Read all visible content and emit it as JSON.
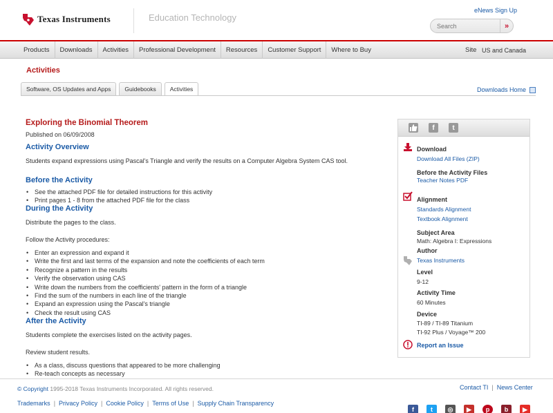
{
  "header": {
    "brand": "Texas Instruments",
    "section": "Education Technology",
    "enews_link": "eNews Sign Up",
    "search_placeholder": "Search"
  },
  "nav": {
    "items": [
      "Products",
      "Downloads",
      "Activities",
      "Professional Development",
      "Resources",
      "Customer Support",
      "Where to Buy"
    ],
    "site_label": "Site",
    "site_value": "US and Canada"
  },
  "page": {
    "section_title": "Activities",
    "tabs": [
      "Software, OS Updates and Apps",
      "Guidebooks",
      "Activities"
    ],
    "active_tab": "Activities",
    "downloads_home": "Downloads Home"
  },
  "activity": {
    "title": "Exploring the Binomial Theorem",
    "published": "Published on 06/09/2008",
    "overview_heading": "Activity Overview",
    "overview_text": "Students expand expressions using Pascal's Triangle and verify the results on a Computer Algebra System CAS tool.",
    "before_heading": "Before the Activity",
    "before_items": [
      "See the attached PDF file for detailed instructions for this activity",
      "Print pages 1 - 8 from the attached PDF file for the class"
    ],
    "during_heading": "During the Activity",
    "during_text1": "Distribute the pages to the class.",
    "during_text2": "Follow the Activity procedures:",
    "during_items": [
      "Enter an expression and expand it",
      "Write the first and last terms of the expansion and note the coefficients of each term",
      "Recognize a pattern in the results",
      "Verify the observation using CAS",
      "Write down the numbers from the coefficients' pattern in the form of a triangle",
      "Find the sum of the numbers in each line of the triangle",
      "Expand an expression using the Pascal's triangle",
      "Check the result using CAS"
    ],
    "after_heading": "After the Activity",
    "after_text1": "Students complete the exercises listed on the activity pages.",
    "after_text2": "Review student results.",
    "after_items": [
      "As a class, discuss questions that appeared to be more challenging",
      "Re-teach concepts as necessary"
    ]
  },
  "sidebar": {
    "download_label": "Download",
    "download_link": "Download All Files (ZIP)",
    "before_files_label": "Before the Activity Files",
    "teacher_notes_link": "Teacher Notes PDF",
    "alignment_label": "Alignment",
    "standards_link": "Standards Alignment",
    "textbook_link": "Textbook Alignment",
    "subject_label": "Subject Area",
    "subject_value": "Math: Algebra I: Expressions",
    "author_label": "Author",
    "author_link": "Texas Instruments",
    "level_label": "Level",
    "level_value": "9-12",
    "time_label": "Activity Time",
    "time_value": "60 Minutes",
    "device_label": "Device",
    "device_value1": "TI-89 / TI-89 Titanium",
    "device_value2": "TI-92 Plus / Voyage™ 200",
    "report_link": "Report an Issue"
  },
  "footer": {
    "copyright_symbol": "© Copyright",
    "copyright_text": "1995-2018 Texas Instruments Incorporated. All rights reserved.",
    "contact_link": "Contact TI",
    "news_link": "News Center",
    "separator": "|",
    "links": [
      "Trademarks",
      "Privacy Policy",
      "Cookie Policy",
      "Terms of Use",
      "Supply Chain Transparency"
    ]
  },
  "colors": {
    "brand_red": "#cc0000",
    "link_blue": "#1a5aa6",
    "title_red": "#b51b1b"
  }
}
